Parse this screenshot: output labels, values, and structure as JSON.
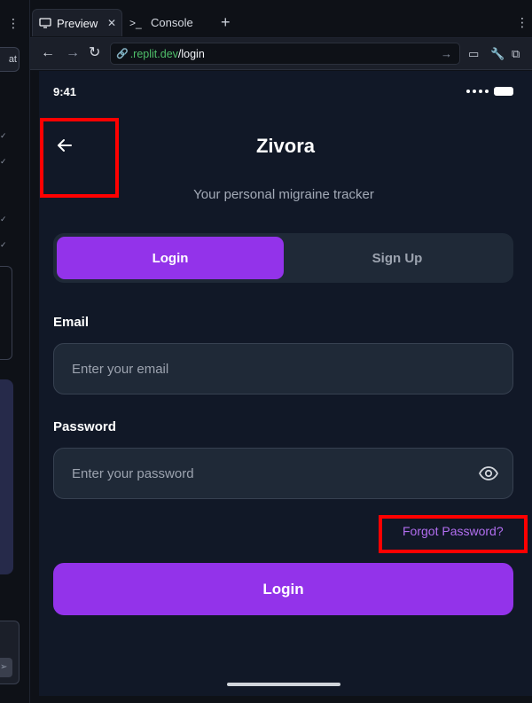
{
  "browser": {
    "tabs": [
      {
        "label": "Preview",
        "icon": "monitor-icon",
        "active": true
      },
      {
        "label": "Console",
        "icon": "terminal-icon",
        "active": false
      }
    ],
    "url_host": ".replit.dev",
    "url_path": "/login"
  },
  "left_panel": {
    "button_label": "at"
  },
  "status": {
    "time": "9:41"
  },
  "app": {
    "title": "Zivora",
    "subtitle": "Your personal migraine tracker",
    "toggle": {
      "login_label": "Login",
      "signup_label": "Sign Up",
      "selected": "Login"
    },
    "email": {
      "label": "Email",
      "placeholder": "Enter your email",
      "value": ""
    },
    "password": {
      "label": "Password",
      "placeholder": "Enter your password",
      "value": ""
    },
    "forgot_label": "Forgot Password?",
    "submit_label": "Login"
  },
  "colors": {
    "accent": "#9333ea",
    "link": "#b26ef0",
    "background": "#111827",
    "surface": "#1f2937",
    "highlight_box": "#ff0000"
  }
}
